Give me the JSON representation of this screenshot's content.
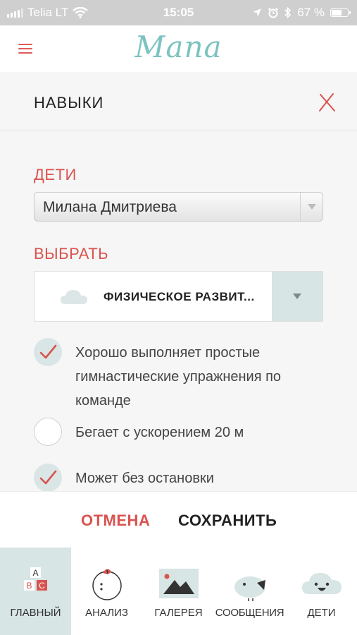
{
  "status_bar": {
    "carrier": "Telia LT",
    "time": "15:05",
    "battery_text": "67 %",
    "battery_level": 0.67
  },
  "header": {
    "logo": "Mana"
  },
  "panel": {
    "title": "НАВЫКИ",
    "children_label": "ДЕТИ",
    "child_selected": "Милана Дмитриева",
    "choose_label": "ВЫБРАТЬ",
    "category_selected": "ФИЗИЧЕСКОЕ РАЗВИТ...",
    "skills": [
      {
        "text": "Хорошо выполняет простые гимнастические упражнения по команде",
        "checked": true
      },
      {
        "text": "Бегает с ускорением 20 м",
        "checked": false
      },
      {
        "text": "Может без остановки",
        "checked": true
      }
    ]
  },
  "actions": {
    "cancel_label": "ОТМЕНА",
    "save_label": "СОХРАНИТЬ"
  },
  "tabs": [
    {
      "label": "ГЛАВНЫЙ",
      "icon": "abc-blocks-icon",
      "active": true
    },
    {
      "label": "АНАЛИЗ",
      "icon": "apple-icon",
      "active": false
    },
    {
      "label": "ГАЛЕРЕЯ",
      "icon": "picture-icon",
      "active": false
    },
    {
      "label": "СООБЩЕНИЯ",
      "icon": "bird-icon",
      "active": false
    },
    {
      "label": "ДЕТИ",
      "icon": "cloud-face-icon",
      "active": false
    }
  ],
  "colors": {
    "accent_red": "#d9534f",
    "accent_teal": "#7cc3c0",
    "active_tab_bg": "#d7e5e4"
  }
}
